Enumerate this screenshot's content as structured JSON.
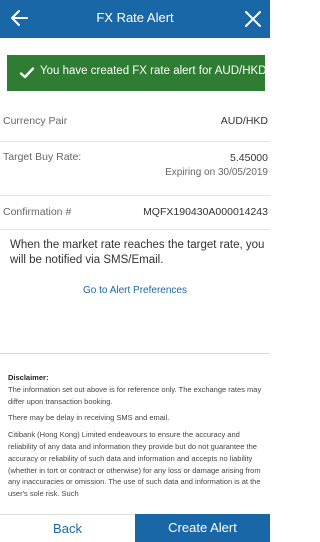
{
  "header": {
    "title": "FX Rate Alert",
    "back_icon": "arrow-left-icon",
    "close_icon": "close-icon"
  },
  "banner": {
    "icon": "checkmark-icon",
    "message": "You have created FX rate alert for AUD/HKD .",
    "color": "#2e7d32"
  },
  "details": {
    "currency_pair": {
      "label": "Currency Pair",
      "value": "AUD/HKD"
    },
    "target_buy_rate": {
      "label": "Target Buy Rate:",
      "value": "5.45000",
      "expiry": "Expiring on 30/05/2019"
    },
    "confirmation": {
      "label": "Confirmation #",
      "value": "MQFX190430A000014243"
    }
  },
  "info_text": "When the market rate reaches the target rate, you will be notified via SMS/Email.",
  "preferences_link": "Go to Alert Preferences",
  "disclaimer": {
    "title": "Disclaimer:",
    "paragraphs": [
      "The information set out above is for reference only. The exchange rates may differ upon transaction booking.",
      "There may be delay in receiving SMS and email.",
      "Citibank (Hong Kong) Limited endeavours to ensure the accuracy and reliability of any data and information they provide but do not guarantee the accuracy or reliability of such data and information and accepts no liability (whether in tort or contract or otherwise) for any loss or damage arising from any inaccuracies or omission. The use of such data and information is at the user's sole risk. Such"
    ]
  },
  "footer": {
    "back_label": "Back",
    "create_label": "Create Alert"
  },
  "colors": {
    "primary": "#1a67a8",
    "success": "#2e7d32"
  }
}
